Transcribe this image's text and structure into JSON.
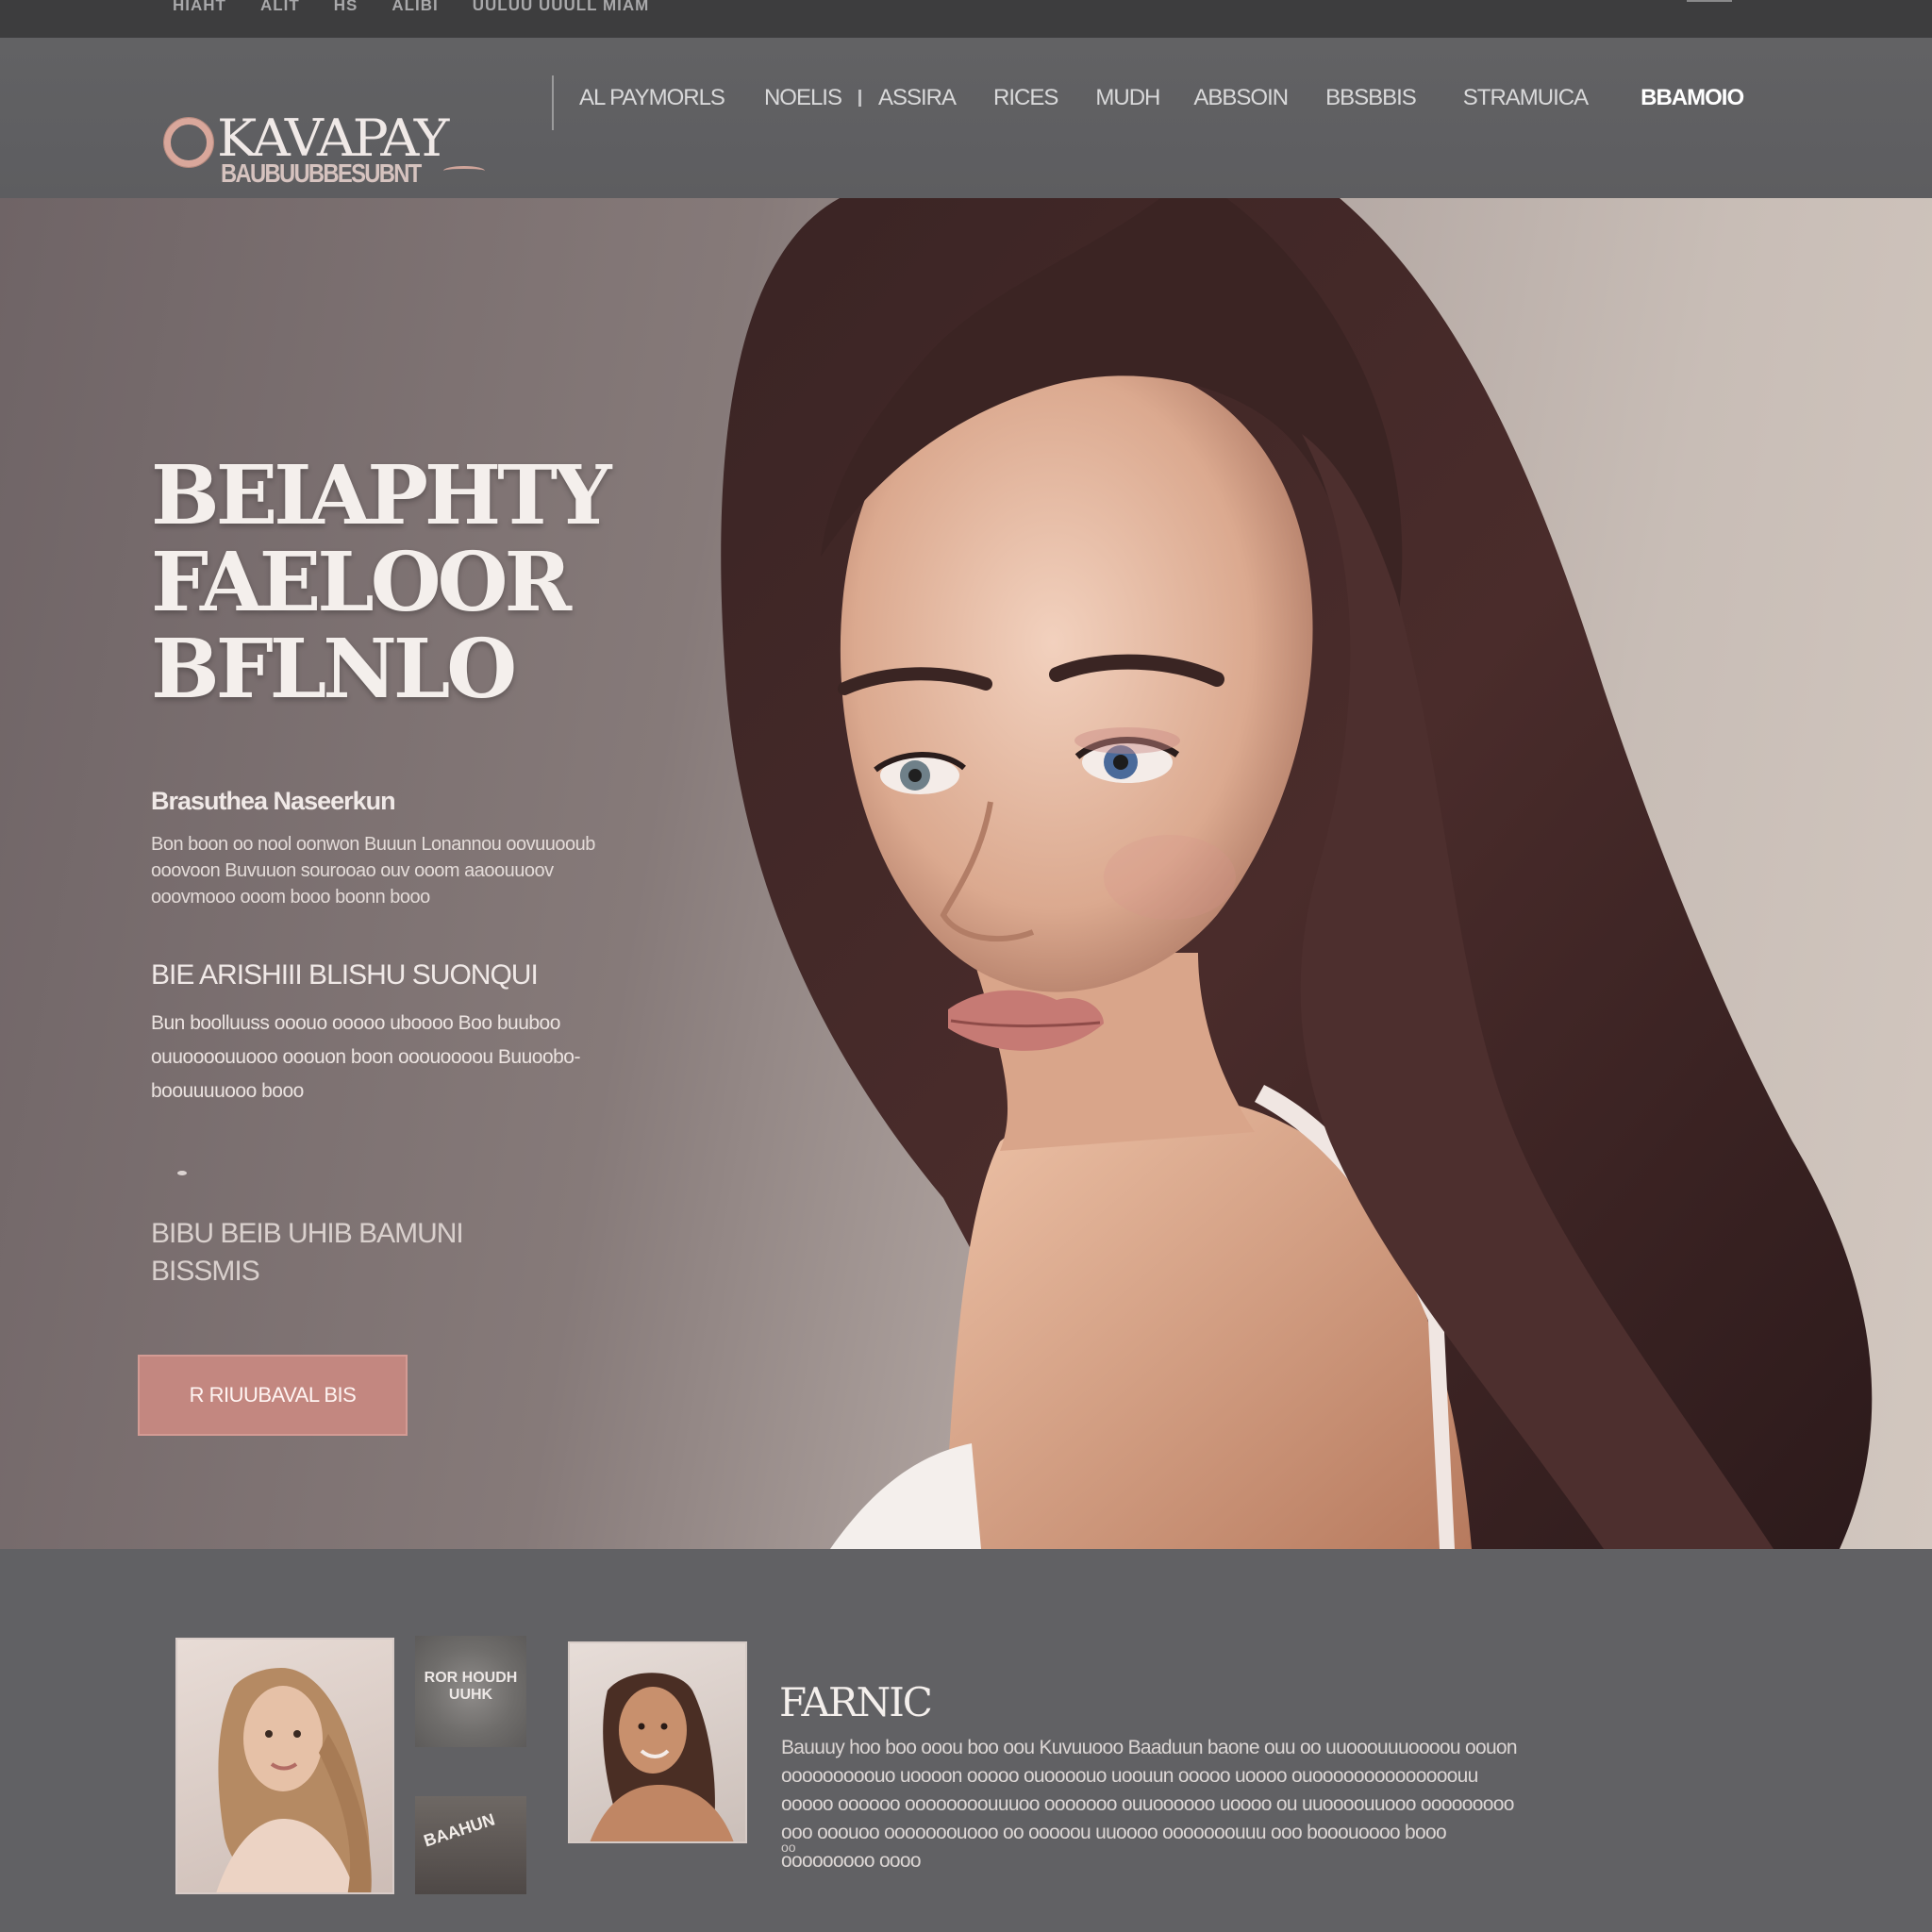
{
  "topbar": {
    "links": [
      "HIAHT",
      "ALIT",
      "HS",
      "ALIBI",
      "UULUU UUULL MIAM"
    ]
  },
  "header": {
    "logo_name": "KAVAPAY",
    "logo_tagline": "BAUBUUBBESUBNT",
    "nav": [
      "AL PAYMORLS",
      "NOELIS",
      "ASSIRA",
      "RICES",
      "MUDH",
      "ABBSOIN",
      "BBSBBIS",
      "STRAMUICA",
      "BBAMOIO"
    ]
  },
  "hero": {
    "title_lines": [
      "BEIAPHTY",
      "FAELOOR",
      "BFLNLO"
    ],
    "subheading": "Brasuthea Naseerkun",
    "paragraph": "Bon boon oo nool oonwon Buuun Lonannou oovuuooub ooovoon Buvuuon sourooao ouv ooom aaoouuoov ooovmooo ooom booo boonn booo",
    "subheading2": "BIE ARISHIII BLISHU SUONQUI",
    "paragraph2": "Bun boolluuss ooouo ooooo uboooo Boo buuboo ouuoooouuooo ooouon boon ooouoooou Buuoobo-boouuuuooo booo",
    "note": "BIBU BEIB UHIB BAMUNI BISSMIS",
    "cta_label": "R RIUUBAVAL BIS"
  },
  "lower": {
    "badge_text": "ROR HOUDH UUHK",
    "badge_text2": "BAAHUN",
    "title": "FARNIC",
    "paragraph": "Bauuuy hoo boo ooou boo oou Kuvuuooo Baaduun baone ouu oo uuooouuuoooou oouon ooooooooouo uoooon ooooo ouoooouo uoouun ooooo uoooo ouoooooooooooooouu ooooo oooooo oooooooouuuoo ooooooo ouuoooooo uoooo ou uuoooouuooo ooooooooo ooo ooouoo ooooooouooo oo ooooou uuoooo ooooooouuu ooo booouoooo booo ooooooooo oooo",
    "small": "oo"
  },
  "colors": {
    "accent": "#c38780",
    "header_bg": "#616164",
    "hero_text": "#f4efec"
  }
}
